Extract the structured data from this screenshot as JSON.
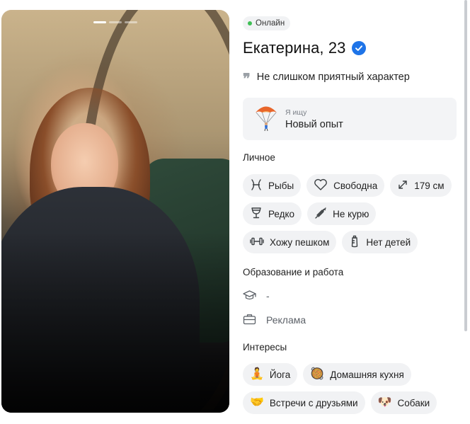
{
  "profile": {
    "status": "Онлайн",
    "name_age": "Екатерина, 23",
    "about": "Не слишком приятный характер",
    "photo_pages": 3
  },
  "seeking": {
    "label": "Я ищу",
    "value": "Новый опыт",
    "icon": "parachute-icon"
  },
  "personal": {
    "title": "Личное",
    "chips": [
      {
        "label": "Рыбы",
        "icon": "pisces-icon"
      },
      {
        "label": "Свободна",
        "icon": "heart-icon"
      },
      {
        "label": "179 см",
        "icon": "height-arrows-icon"
      },
      {
        "label": "Редко",
        "icon": "wine-glass-icon"
      },
      {
        "label": "Не курю",
        "icon": "no-smoking-icon"
      },
      {
        "label": "Хожу пешком",
        "icon": "dumbbell-icon"
      },
      {
        "label": "Нет детей",
        "icon": "baby-bottle-icon"
      }
    ]
  },
  "education_work": {
    "title": "Образование и работа",
    "education": "-",
    "work": "Реклама"
  },
  "interests": {
    "title": "Интересы",
    "chips": [
      {
        "label": "Йога",
        "emoji": "🧘"
      },
      {
        "label": "Домашняя кухня",
        "emoji": "🥘"
      },
      {
        "label": "Встречи с друзьями",
        "emoji": "🤝"
      },
      {
        "label": "Собаки",
        "emoji": "🐶"
      }
    ]
  },
  "colors": {
    "online": "#3fbf55",
    "verified": "#1e74e8",
    "chip_bg": "#f1f2f4"
  }
}
